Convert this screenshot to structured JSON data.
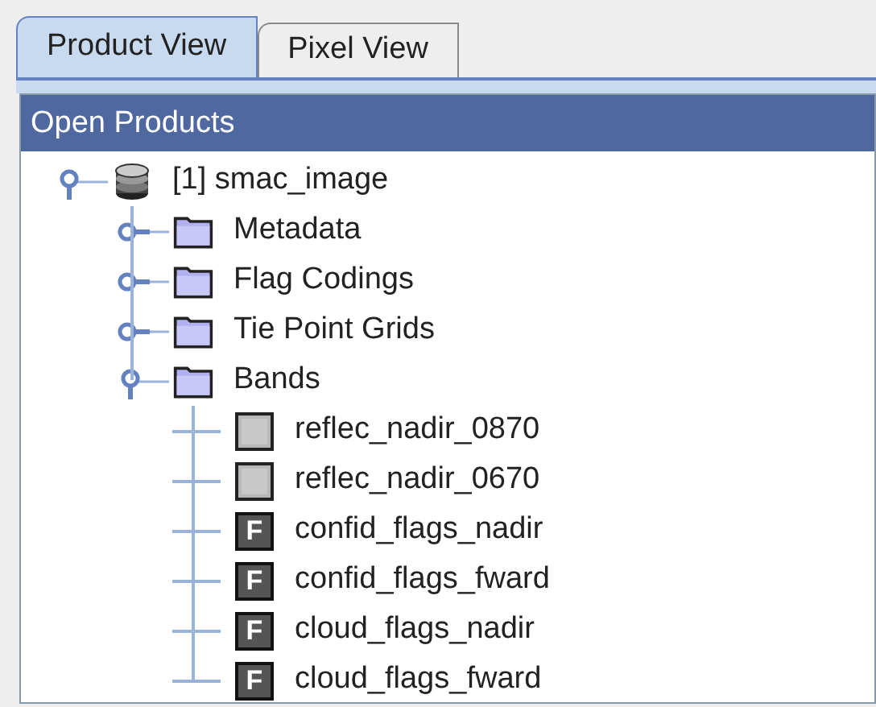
{
  "tabs": [
    {
      "label": "Product View",
      "selected": true
    },
    {
      "label": "Pixel View",
      "selected": false
    }
  ],
  "panel": {
    "title": "Open Products"
  },
  "tree": [
    {
      "label": "[1] smac_image",
      "kind": "product",
      "expanded": true,
      "children": [
        {
          "label": "Metadata",
          "kind": "folder",
          "expanded": false
        },
        {
          "label": "Flag Codings",
          "kind": "folder",
          "expanded": false
        },
        {
          "label": "Tie Point Grids",
          "kind": "folder",
          "expanded": false
        },
        {
          "label": "Bands",
          "kind": "folder",
          "expanded": true,
          "children": [
            {
              "label": "reflec_nadir_0870",
              "kind": "raster"
            },
            {
              "label": "reflec_nadir_0670",
              "kind": "raster"
            },
            {
              "label": "confid_flags_nadir",
              "kind": "flag",
              "icon_text": "F"
            },
            {
              "label": "confid_flags_fward",
              "kind": "flag",
              "icon_text": "F"
            },
            {
              "label": "cloud_flags_nadir",
              "kind": "flag",
              "icon_text": "F"
            },
            {
              "label": "cloud_flags_fward",
              "kind": "flag",
              "icon_text": "F"
            }
          ]
        }
      ]
    }
  ]
}
